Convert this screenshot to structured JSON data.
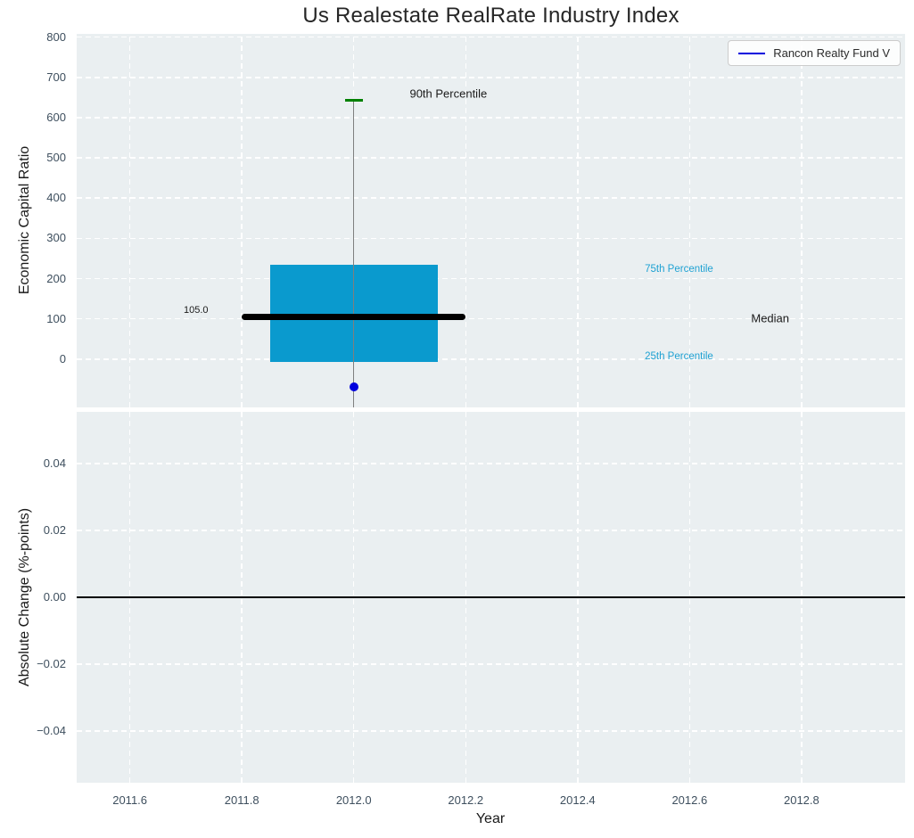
{
  "title": "Us Realestate RealRate Industry Index",
  "legend": {
    "label": "Rancon Realty Fund V"
  },
  "x_axis": {
    "label": "Year",
    "tick_values": [
      2011.6,
      2011.8,
      2012.0,
      2012.2,
      2012.4,
      2012.6,
      2012.8
    ],
    "tick_labels": [
      "2011.6",
      "2011.8",
      "2012.0",
      "2012.2",
      "2012.4",
      "2012.6",
      "2012.8"
    ],
    "range": [
      2011.505,
      2012.985
    ]
  },
  "top_axis": {
    "ylabel": "Economic Capital Ratio",
    "tick_values": [
      800,
      700,
      600,
      500,
      400,
      300,
      200,
      100,
      0
    ],
    "tick_labels": [
      "800",
      "700",
      "600",
      "500",
      "400",
      "300",
      "200",
      "100",
      "0"
    ],
    "range": [
      -120,
      808
    ]
  },
  "bottom_axis": {
    "ylabel": "Absolute Change (%-points)",
    "tick_values": [
      0.04,
      0.02,
      0.0,
      -0.02,
      -0.04
    ],
    "tick_labels": [
      "0.04",
      "0.02",
      "0.00",
      "−0.02",
      "−0.04"
    ],
    "range": [
      -0.0555,
      0.0555
    ]
  },
  "colors": {
    "plot_bg": "#eaeff1",
    "grid": "#ffffff",
    "box_fill": "#0a9ace",
    "median_line": "#000000",
    "whisker": "#7f7f7f",
    "p90_cap": "#008000",
    "fund_point": "#0000dd",
    "cyan_text": "#20a2d3",
    "dark_text": "#1a1a1a",
    "tick_text": "#3e4f5e",
    "zero_line": "#000000"
  },
  "chart_data": [
    {
      "type": "boxplot",
      "panel": "top",
      "title": "Us Realestate RealRate Industry Index",
      "xlabel": "Year",
      "ylabel": "Economic Capital Ratio",
      "xlim": [
        2011.505,
        2012.985
      ],
      "ylim": [
        -120,
        808
      ],
      "grid": true,
      "x": 2012.0,
      "box": {
        "p90": 643,
        "p75": 235,
        "median": 105.0,
        "p25": -8,
        "whisker_low_clipped_at": -120,
        "box_half_width": 0.15,
        "median_half_width": 0.2,
        "cap_half_width": 0.016
      },
      "point": {
        "name": "Rancon Realty Fund V",
        "x": 2012.0,
        "y": -70
      },
      "annotations": [
        {
          "text": "90th Percentile",
          "x": 2012.1,
          "y": 660,
          "ha": "left",
          "color": "#1a1a1a",
          "size": 13
        },
        {
          "text": "75th Percentile",
          "x": 2012.52,
          "y": 223,
          "ha": "left",
          "color": "#20a2d3",
          "size": 11.5
        },
        {
          "text": "Median",
          "x": 2012.71,
          "y": 102,
          "ha": "left",
          "color": "#1a1a1a",
          "size": 13
        },
        {
          "text": "25th Percentile",
          "x": 2012.52,
          "y": 7,
          "ha": "left",
          "color": "#20a2d3",
          "size": 11.5
        },
        {
          "text": "105.0",
          "x": 2011.74,
          "y": 122,
          "ha": "right",
          "color": "#1a1a1a",
          "size": 11
        }
      ],
      "legend": {
        "label": "Rancon Realty Fund V",
        "position": "upper right"
      }
    },
    {
      "type": "line",
      "panel": "bottom",
      "ylabel": "Absolute Change (%-points)",
      "xlim": [
        2011.505,
        2012.985
      ],
      "ylim": [
        -0.0555,
        0.0555
      ],
      "grid": true,
      "zero_line_y": 0.0,
      "series": [
        {
          "name": "Rancon Realty Fund V",
          "x": [],
          "y": []
        }
      ]
    }
  ]
}
